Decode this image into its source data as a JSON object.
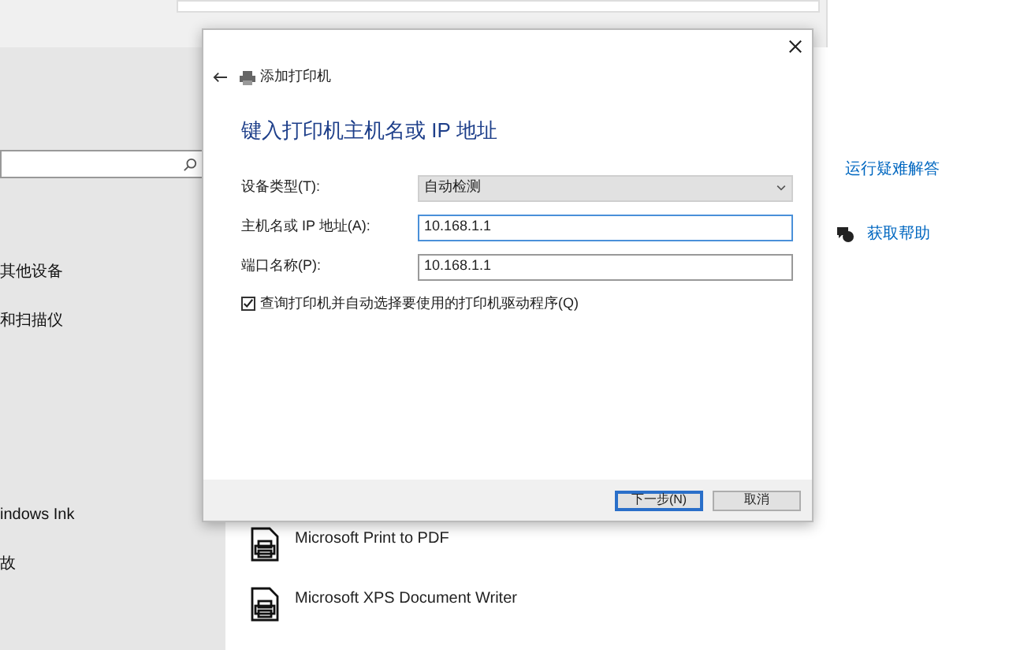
{
  "settings": {
    "sidebar_items": [
      "其他设备",
      "和扫描仪",
      "indows Ink",
      "故"
    ],
    "links": [
      {
        "label": "运行疑难解答",
        "kind": "link"
      },
      {
        "label": "获取帮助",
        "kind": "help"
      }
    ],
    "printers": [
      "Microsoft Print to PDF",
      "Microsoft XPS Document Writer"
    ]
  },
  "dialog": {
    "title": "添加打印机",
    "heading": "键入打印机主机名或 IP 地址",
    "fields": [
      {
        "label": "设备类型(T):",
        "kind": "select",
        "value": "自动检测",
        "focused": false
      },
      {
        "label": "主机名或 IP 地址(A):",
        "kind": "input",
        "value": "10.168.1.1",
        "focused": true
      },
      {
        "label": "端口名称(P):",
        "kind": "input",
        "value": "10.168.1.1",
        "focused": false
      }
    ],
    "checkbox": {
      "label": "查询打印机并自动选择要使用的打印机驱动程序(Q)",
      "checked": true
    },
    "buttons": [
      {
        "label": "下一步(N)",
        "default": true
      },
      {
        "label": "取消",
        "default": false
      }
    ]
  }
}
